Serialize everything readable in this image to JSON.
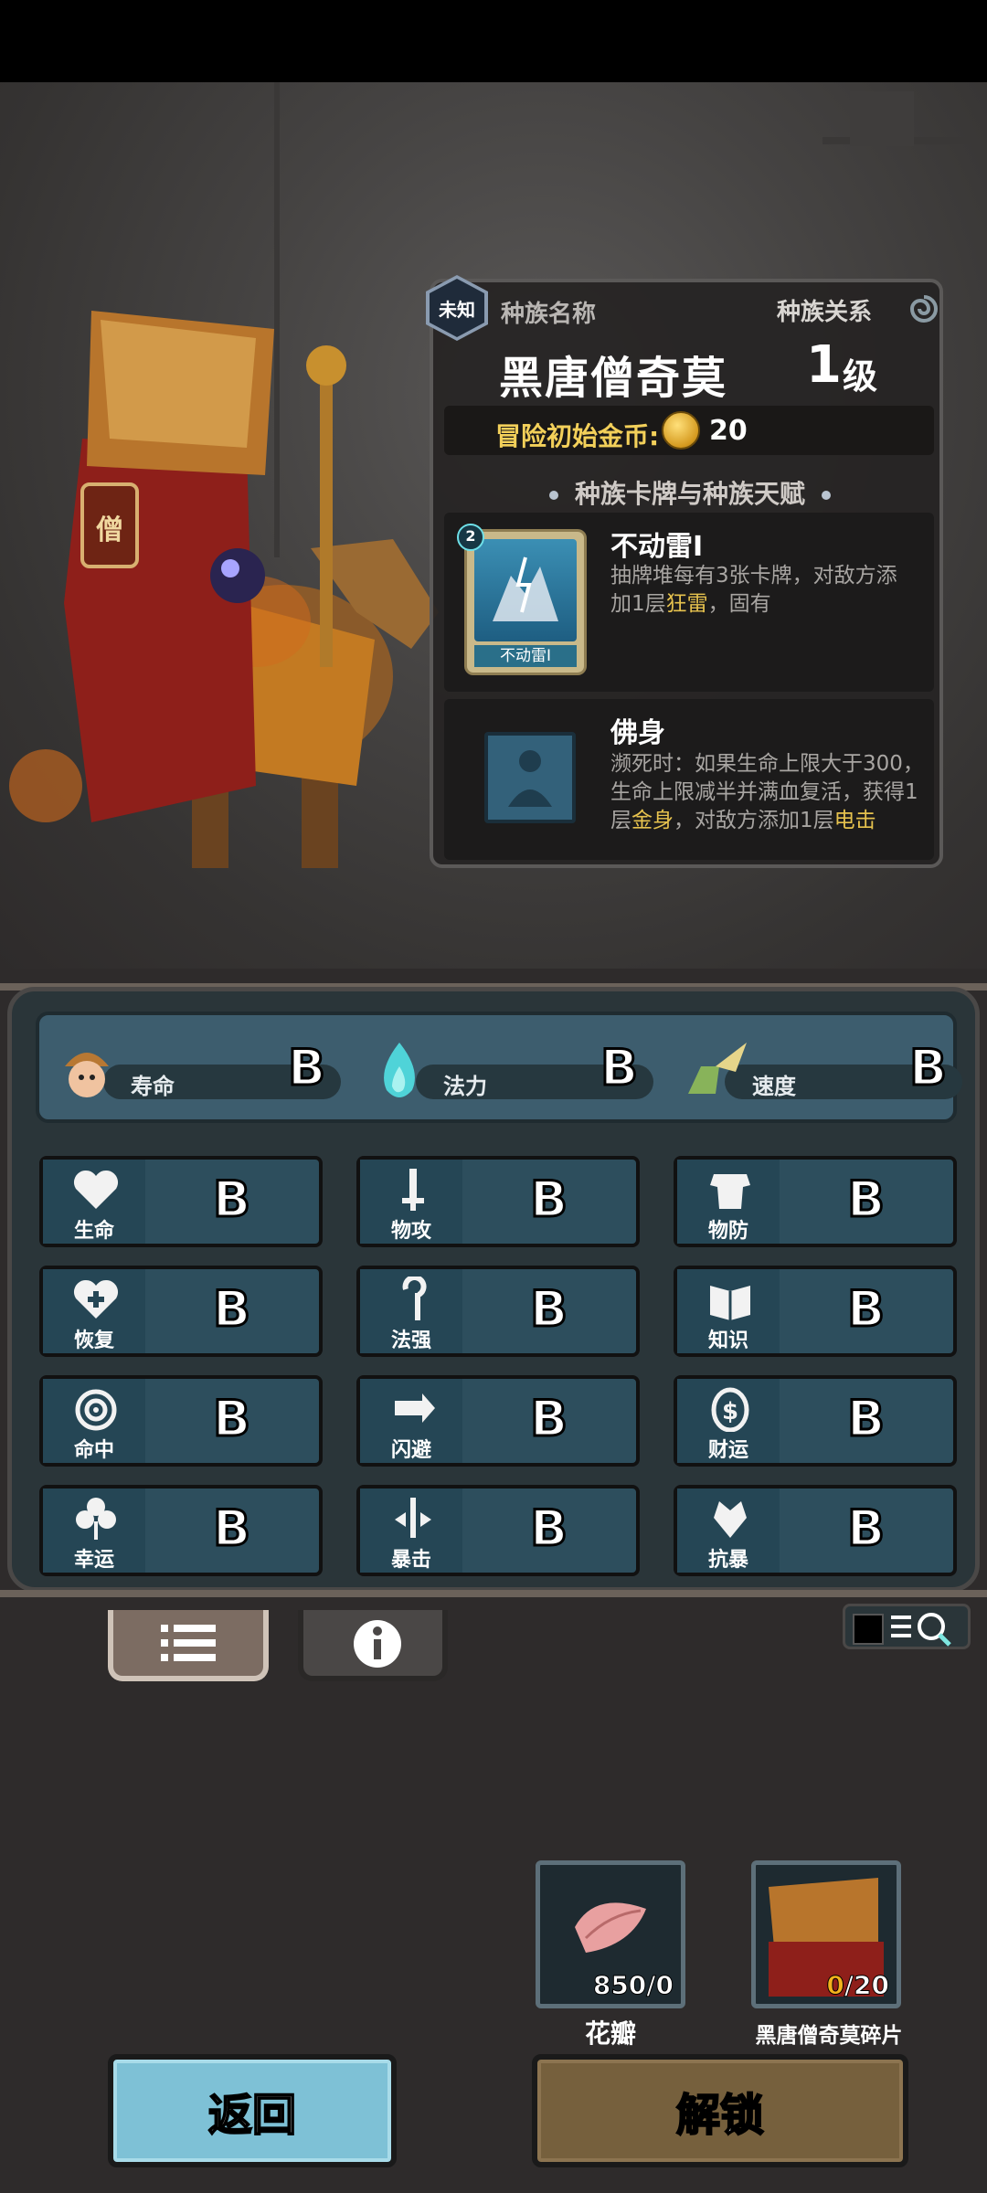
{
  "info": {
    "unknown_badge": "未知",
    "race_name_label": "种族名称",
    "race_relation_label": "种族关系",
    "race_name": "黑唐僧奇莫",
    "level_value": "1",
    "level_unit": "级",
    "gold_label": "冒险初始金币:",
    "gold_value": "20",
    "section_title": "种族卡牌与种族天赋",
    "card": {
      "badge": "2",
      "art_label": "不动雷I",
      "title": "不动雷I",
      "desc_1": "抽牌堆每有3张卡牌，对敌方添",
      "desc_2_pre": "加1层",
      "desc_2_hl": "狂雷",
      "desc_2_post": "，固有"
    },
    "talent": {
      "title": "佛身",
      "desc_1": "濒死时：如果生命上限大于300，",
      "desc_2": "生命上限减半并满血复活，获得1",
      "desc_3_pre": "层",
      "desc_3_hl1": "金身",
      "desc_3_mid": "，对敌方添加1层",
      "desc_3_hl2": "电击"
    }
  },
  "top_stats": [
    {
      "label": "寿命",
      "grade": "B",
      "icon": "acorn-head-icon"
    },
    {
      "label": "法力",
      "grade": "B",
      "icon": "blue-flame-icon"
    },
    {
      "label": "速度",
      "grade": "B",
      "icon": "winged-boot-icon"
    }
  ],
  "stats": [
    {
      "label": "生命",
      "grade": "B",
      "icon": "heart-icon"
    },
    {
      "label": "物攻",
      "grade": "B",
      "icon": "sword-icon"
    },
    {
      "label": "物防",
      "grade": "B",
      "icon": "armor-icon"
    },
    {
      "label": "恢复",
      "grade": "B",
      "icon": "heart-plus-icon"
    },
    {
      "label": "法强",
      "grade": "B",
      "icon": "staff-icon"
    },
    {
      "label": "知识",
      "grade": "B",
      "icon": "book-icon"
    },
    {
      "label": "命中",
      "grade": "B",
      "icon": "target-icon"
    },
    {
      "label": "闪避",
      "grade": "B",
      "icon": "dodge-arrow-icon"
    },
    {
      "label": "财运",
      "grade": "B",
      "icon": "coin-icon"
    },
    {
      "label": "幸运",
      "grade": "B",
      "icon": "clover-icon"
    },
    {
      "label": "暴击",
      "grade": "B",
      "icon": "crit-sword-icon"
    },
    {
      "label": "抗暴",
      "grade": "B",
      "icon": "shield-flower-icon"
    }
  ],
  "items": [
    {
      "name": "花瓣",
      "count": "850/0"
    },
    {
      "name": "黑唐僧奇莫碎片",
      "count_have": "0",
      "count_need": "/20"
    }
  ],
  "buttons": {
    "back": "返回",
    "unlock": "解锁"
  },
  "colors": {
    "highlight": "#e6c24e",
    "back_button": "#7ec1d6",
    "unlock_button": "#76603d"
  }
}
